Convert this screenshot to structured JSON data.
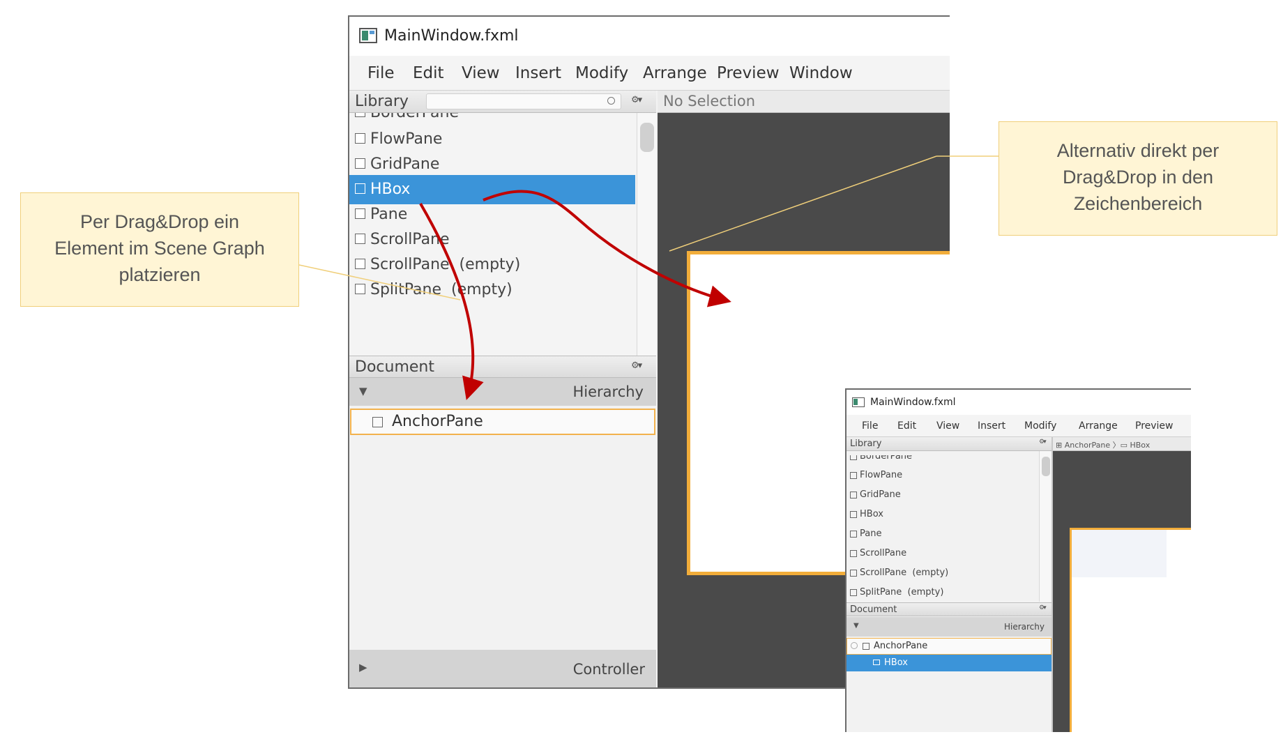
{
  "main_window": {
    "title": "MainWindow.fxml",
    "menu": [
      "File",
      "Edit",
      "View",
      "Insert",
      "Modify",
      "Arrange",
      "Preview",
      "Window"
    ],
    "library": {
      "label": "Library",
      "items": [
        {
          "label": "BorderPane",
          "selected": false
        },
        {
          "label": "FlowPane",
          "selected": false
        },
        {
          "label": "GridPane",
          "selected": false
        },
        {
          "label": "HBox",
          "selected": true
        },
        {
          "label": "Pane",
          "selected": false
        },
        {
          "label": "ScrollPane",
          "selected": false
        },
        {
          "label": "ScrollPane  (empty)",
          "selected": false
        },
        {
          "label": "SplitPane  (empty)",
          "selected": false
        }
      ]
    },
    "document": {
      "label": "Document",
      "hierarchy_label": "Hierarchy",
      "tree": [
        "AnchorPane"
      ],
      "controller_label": "Controller"
    },
    "selection_text": "No Selection"
  },
  "small_window": {
    "title": "MainWindow.fxml",
    "menu": [
      "File",
      "Edit",
      "View",
      "Insert",
      "Modify",
      "Arrange",
      "Preview"
    ],
    "library": {
      "label": "Library",
      "items": [
        "BorderPane",
        "FlowPane",
        "GridPane",
        "HBox",
        "Pane",
        "ScrollPane",
        "ScrollPane  (empty)",
        "SplitPane  (empty)"
      ]
    },
    "breadcrumb": "⊞ AnchorPane 〉▭ HBox",
    "document": {
      "label": "Document",
      "hierarchy_label": "Hierarchy",
      "tree": [
        {
          "label": "AnchorPane",
          "selected": false
        },
        {
          "label": "HBox",
          "selected": true
        }
      ]
    }
  },
  "callouts": {
    "left": [
      "Per Drag&Drop ein",
      "Element im Scene Graph",
      "platzieren"
    ],
    "right": [
      "Alternativ direkt per",
      "Drag&Drop in den",
      "Zeichenbereich"
    ]
  },
  "colors": {
    "selection": "#3b94d9",
    "anchor_border": "#f2ad3a",
    "canvas": "#4a4a4a",
    "callout_fill": "#fff5d5",
    "arrow": "#c00000"
  }
}
